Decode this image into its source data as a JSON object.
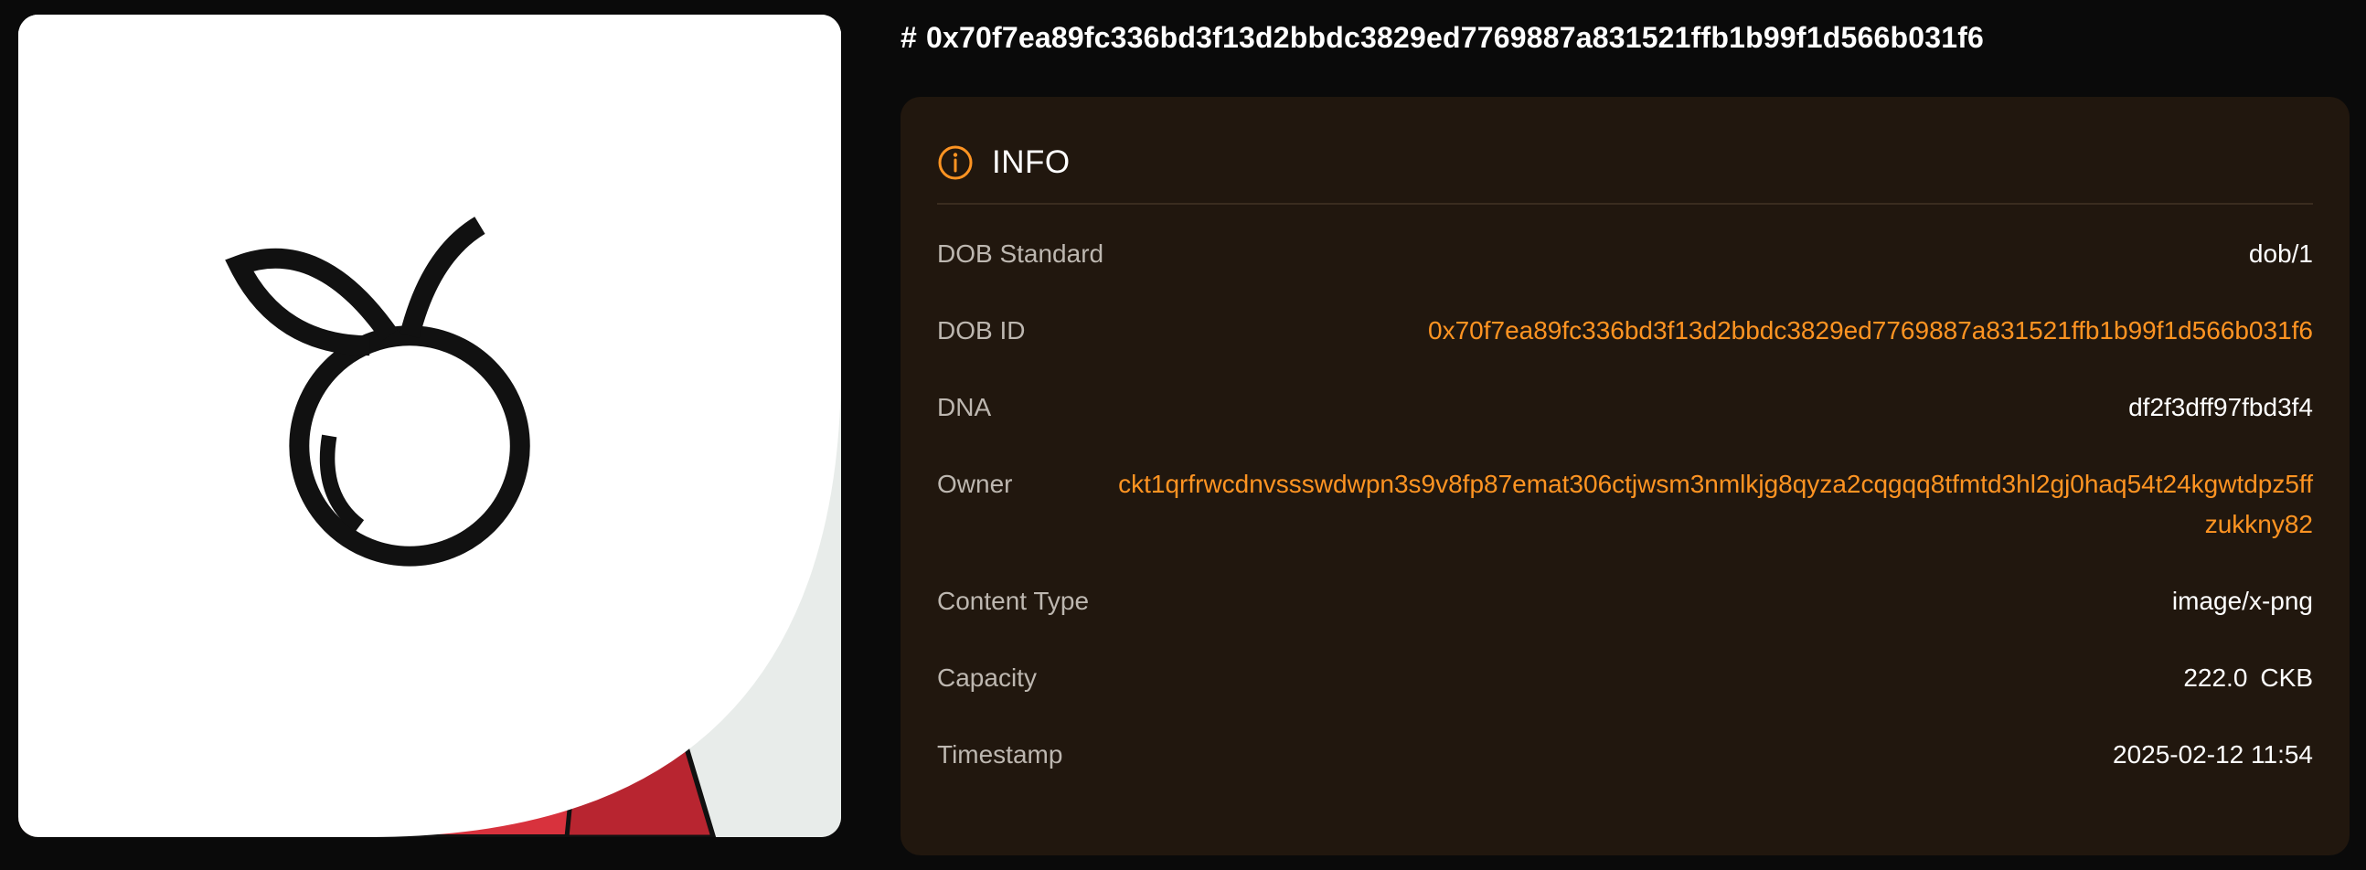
{
  "title": {
    "hash": "#",
    "dob_id": "0x70f7ea89fc336bd3f13d2bbdc3829ed7769887a831521ffb1b99f1d566b031f6"
  },
  "info": {
    "heading": "INFO",
    "rows": {
      "dob_standard": {
        "label": "DOB Standard",
        "value": "dob/1"
      },
      "dob_id": {
        "label": "DOB ID",
        "value": "0x70f7ea89fc336bd3f13d2bbdc3829ed7769887a831521ffb1b99f1d566b031f6"
      },
      "dna": {
        "label": "DNA",
        "value": "df2f3dff97fbd3f4"
      },
      "owner": {
        "label": "Owner",
        "value": "ckt1qrfrwcdnvssswdwpn3s9v8fp87emat306ctjwsm3nmlkjg8qyza2cqgqq8tfmtd3hl2gj0haq54t24kgwtdpz5ffzukkny82"
      },
      "content_type": {
        "label": "Content Type",
        "value": "image/x-png"
      },
      "capacity": {
        "label": "Capacity",
        "value": "222.0",
        "unit": "CKB"
      },
      "timestamp": {
        "label": "Timestamp",
        "value": "2025-02-12 11:54"
      }
    }
  },
  "colors": {
    "background": "#0a0a0a",
    "card": "#21170e",
    "accent": "#ff9422",
    "label": "#bdb7b0"
  },
  "icons": {
    "badge": "fruit-logo-icon",
    "info": "info-circle-icon"
  }
}
